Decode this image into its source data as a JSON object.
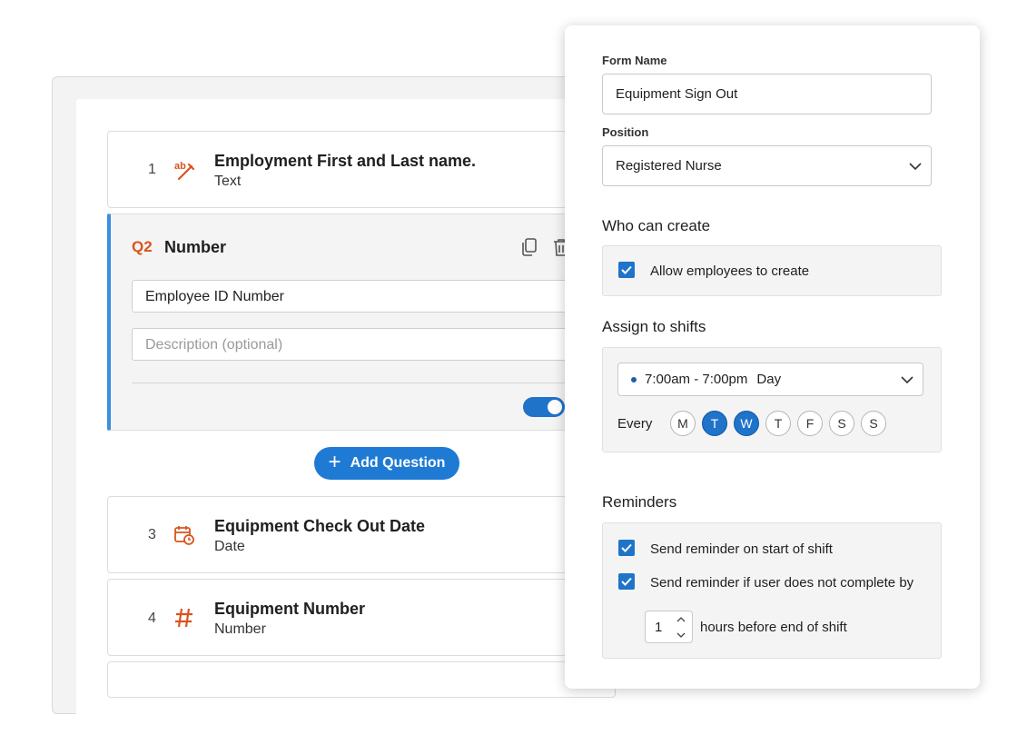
{
  "builder": {
    "questions": [
      {
        "number": "1",
        "title": "Employment First and Last name.",
        "type": "Text",
        "icon": "text-abc-icon"
      },
      {
        "number": "3",
        "title": "Equipment Check Out Date",
        "type": "Date",
        "icon": "calendar-clock-icon"
      },
      {
        "number": "4",
        "title": "Equipment Number",
        "type": "Number",
        "icon": "hash-icon"
      }
    ],
    "active_question": {
      "tag": "Q2",
      "type_title": "Number",
      "value": "Employee ID Number",
      "description_placeholder": "Description (optional)",
      "required_toggle_on": true
    },
    "add_question_label": "Add Question"
  },
  "settings": {
    "form_name_label": "Form Name",
    "form_name_value": "Equipment Sign Out",
    "position_label": "Position",
    "position_value": "Registered Nurse",
    "who_can_create_heading": "Who can create",
    "allow_employees_label": "Allow employees to create",
    "allow_employees_checked": true,
    "assign_shifts_heading": "Assign to shifts",
    "shift_time": "7:00am - 7:00pm",
    "shift_name": "Day",
    "every_label": "Every",
    "days": [
      {
        "label": "M",
        "selected": false
      },
      {
        "label": "T",
        "selected": true
      },
      {
        "label": "W",
        "selected": true
      },
      {
        "label": "T",
        "selected": false
      },
      {
        "label": "F",
        "selected": false
      },
      {
        "label": "S",
        "selected": false
      },
      {
        "label": "S",
        "selected": false
      }
    ],
    "reminders_heading": "Reminders",
    "reminder_start_label": "Send reminder on start of shift",
    "reminder_incomplete_label": "Send reminder if user does not complete by",
    "hours_value": "1",
    "hours_suffix": "hours before end of shift"
  },
  "colors": {
    "accent_blue": "#1f73c9",
    "icon_orange": "#d9541e",
    "active_border": "#3a8fe0"
  }
}
